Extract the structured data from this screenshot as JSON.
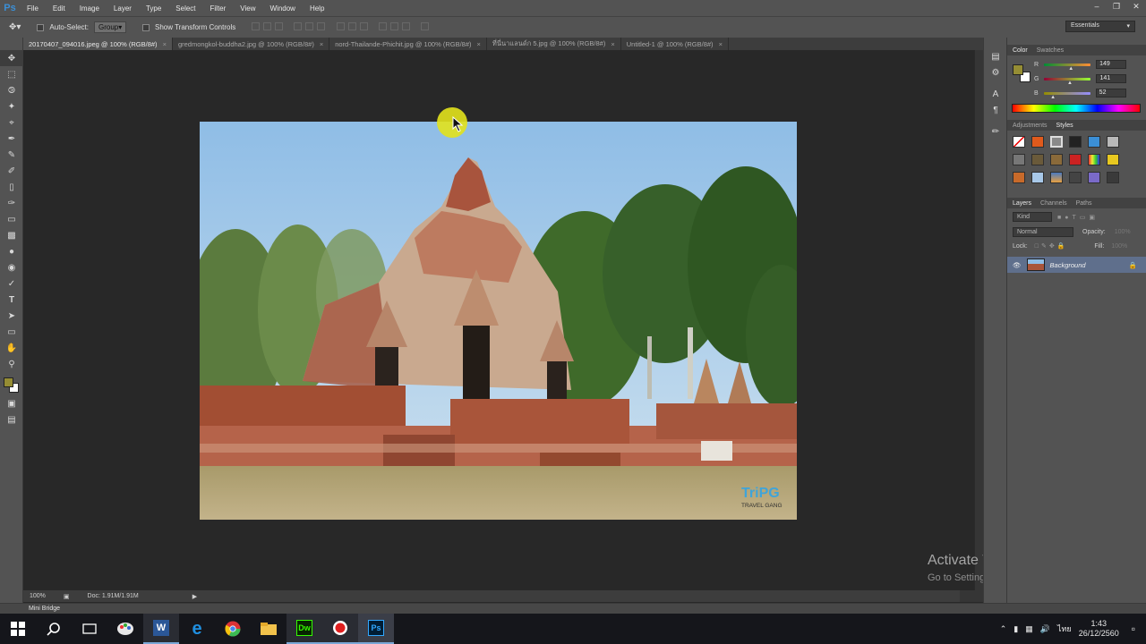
{
  "app": {
    "logo": "Ps"
  },
  "menu": [
    "File",
    "Edit",
    "Image",
    "Layer",
    "Type",
    "Select",
    "Filter",
    "View",
    "Window",
    "Help"
  ],
  "window_controls": [
    "minimize-icon",
    "restore-icon",
    "close-icon"
  ],
  "options_bar": {
    "auto_select_label": "Auto-Select:",
    "auto_select_value": "Group",
    "show_transform_label": "Show Transform Controls",
    "auto_select_checked": false,
    "show_transform_checked": false
  },
  "workspace": "Essentials",
  "tabs": [
    {
      "label": "20170407_094016.jpeg @ 100% (RGB/8#)",
      "active": true
    },
    {
      "label": "gredmongkol-buddha2.jpg @ 100% (RGB/8#)",
      "active": false
    },
    {
      "label": "nord-Thailande-Phichit.jpg @ 100% (RGB/8#)",
      "active": false
    },
    {
      "label": "ที่นี่นาแลนด์ก 5.jpg @ 100% (RGB/8#)",
      "active": false
    },
    {
      "label": "Untitled-1 @ 100% (RGB/8#)",
      "active": false
    }
  ],
  "status": {
    "zoom": "100%",
    "doc": "Doc: 1.91M/1.91M"
  },
  "watermark": {
    "brand": "TriPG",
    "sub": "TRAVEL GANG"
  },
  "activate": {
    "title": "Activate Windows",
    "sub": "Go to Settings to activate Windows."
  },
  "mini_bridge": "Mini Bridge",
  "color_panel": {
    "tabs": [
      "Color",
      "Swatches"
    ],
    "fg_color": "#958D34",
    "r_label": "R",
    "r_value": "149",
    "g_label": "G",
    "g_value": "141",
    "b_label": "B",
    "b_value": "52",
    "r_level": 0.58,
    "g_level": 0.55,
    "b_level": 0.2
  },
  "styles_panel": {
    "tabs": [
      "Adjustments",
      "Styles"
    ]
  },
  "layers_panel": {
    "tabs": [
      "Layers",
      "Channels",
      "Paths"
    ],
    "kind": "Kind",
    "blend": "Normal",
    "opacity_label": "Opacity:",
    "opacity_value": "100%",
    "lock_label": "Lock:",
    "fill_label": "Fill:",
    "fill_value": "100%",
    "layer_name": "Background"
  },
  "taskbar": {
    "apps": [
      "start-icon",
      "search-icon",
      "task-view-icon",
      "paint-icon",
      "word-icon",
      "edge-icon",
      "chrome-icon",
      "explorer-icon",
      "dreamweaver-icon",
      "recorder-icon",
      "photoshop-icon"
    ],
    "dw_label": "Dw",
    "ps_label": "Ps",
    "word_label": "W",
    "lang": "ไทย",
    "time": "1:43",
    "date": "26/12/2560"
  }
}
